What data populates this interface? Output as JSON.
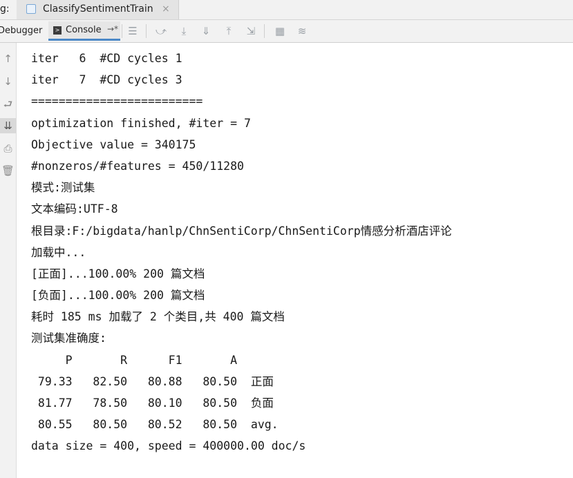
{
  "tab_bar": {
    "prefix": "g:",
    "active_tab": {
      "label": "ClassifySentimentTrain",
      "close": "×"
    }
  },
  "toolbar": {
    "debugger_label": "Debugger",
    "console_label": "Console",
    "console_icon": "console-icon",
    "pin_icon": "→*",
    "buttons": [
      {
        "name": "menu-icon",
        "glyph": "☰"
      },
      {
        "name": "step-over-icon",
        "glyph": "⤻"
      },
      {
        "name": "step-into-icon",
        "glyph": "⤓"
      },
      {
        "name": "force-step-into-icon",
        "glyph": "⇓"
      },
      {
        "name": "step-out-icon",
        "glyph": "⤒"
      },
      {
        "name": "run-to-cursor-icon",
        "glyph": "⇲"
      },
      {
        "name": "evaluate-icon",
        "glyph": "▦"
      },
      {
        "name": "trace-icon",
        "glyph": "≋"
      }
    ]
  },
  "gutter": {
    "buttons": [
      {
        "name": "up-arrow-icon",
        "glyph": "↑"
      },
      {
        "name": "down-arrow-icon",
        "glyph": "↓"
      },
      {
        "name": "soft-wrap-icon",
        "glyph": "⮐"
      },
      {
        "name": "scroll-to-end-icon",
        "glyph": "⇊"
      },
      {
        "name": "print-icon",
        "glyph": "⎙"
      },
      {
        "name": "trash-icon",
        "glyph": "🗑"
      }
    ]
  },
  "console_lines": [
    "iter   6  #CD cycles 1",
    "iter   7  #CD cycles 3",
    "=========================",
    "optimization finished, #iter = 7",
    "Objective value = 340175",
    "#nonzeros/#features = 450/11280",
    "模式:测试集",
    "文本编码:UTF-8",
    "根目录:F:/bigdata/hanlp/ChnSentiCorp/ChnSentiCorp情感分析酒店评论",
    "加载中...",
    "[正面]...100.00% 200 篇文档",
    "[负面]...100.00% 200 篇文档",
    "耗时 185 ms 加载了 2 个类目,共 400 篇文档",
    "测试集准确度:",
    "     P       R      F1       A",
    " 79.33   82.50   80.88   80.50  正面",
    " 81.77   78.50   80.10   80.50  负面",
    " 80.55   80.50   80.52   80.50  avg.",
    "data size = 400, speed = 400000.00 doc/s"
  ]
}
